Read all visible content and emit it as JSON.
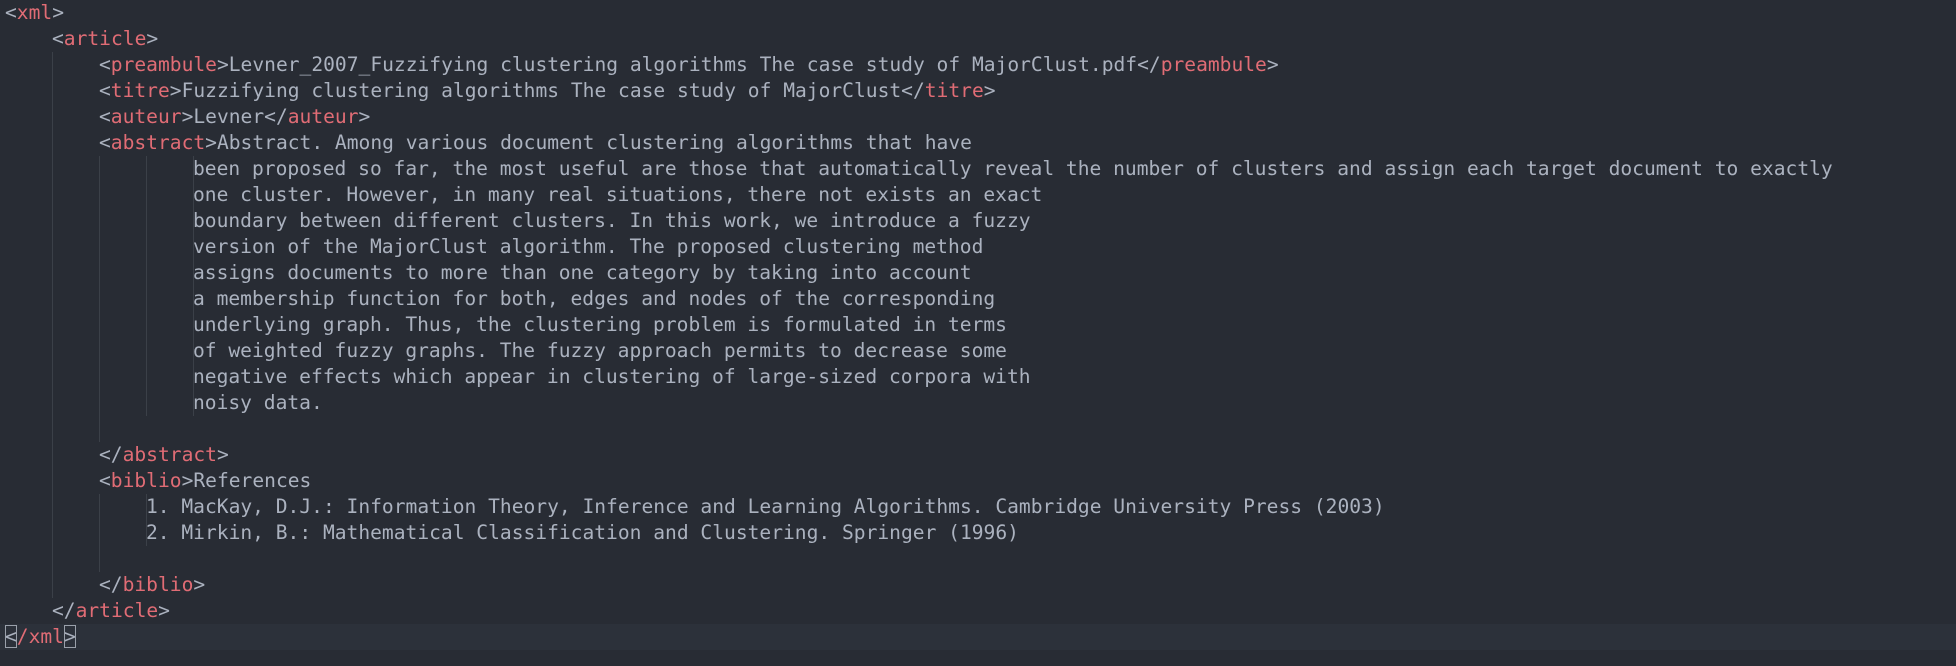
{
  "lines": [
    {
      "open": "<",
      "tag": "xml",
      "close": ">",
      "text": ""
    },
    {
      "open": "<",
      "tag": "article",
      "close": ">",
      "text": ""
    },
    {
      "open": "<",
      "tag": "preambule",
      "close": ">",
      "text": "Levner_2007_Fuzzifying clustering algorithms The case study of MajorClust.pdf",
      "end_open": "</",
      "end_tag": "preambule",
      "end_close": ">"
    },
    {
      "open": "<",
      "tag": "titre",
      "close": ">",
      "text": "Fuzzifying clustering algorithms The case study of MajorClust",
      "end_open": "</",
      "end_tag": "titre",
      "end_close": ">"
    },
    {
      "open": "<",
      "tag": "auteur",
      "close": ">",
      "text": "Levner",
      "end_open": "</",
      "end_tag": "auteur",
      "end_close": ">"
    },
    {
      "open": "<",
      "tag": "abstract",
      "close": ">",
      "text": "Abstract. Among various document clustering algorithms that have"
    },
    {
      "text": "been proposed so far, the most useful are those that automatically reveal the number of clusters and assign each target document to exactly"
    },
    {
      "text": "one cluster. However, in many real situations, there not exists an exact"
    },
    {
      "text": "boundary between different clusters. In this work, we introduce a fuzzy"
    },
    {
      "text": "version of the MajorClust algorithm. The proposed clustering method"
    },
    {
      "text": "assigns documents to more than one category by taking into account"
    },
    {
      "text": "a membership function for both, edges and nodes of the corresponding"
    },
    {
      "text": "underlying graph. Thus, the clustering problem is formulated in terms"
    },
    {
      "text": "of weighted fuzzy graphs. The fuzzy approach permits to decrease some"
    },
    {
      "text": "negative effects which appear in clustering of large-sized corpora with"
    },
    {
      "text": "noisy data."
    },
    {
      "text": ""
    },
    {
      "open": "</",
      "tag": "abstract",
      "close": ">",
      "text": ""
    },
    {
      "open": "<",
      "tag": "biblio",
      "close": ">",
      "text": "References"
    },
    {
      "text": "1. MacKay, D.J.: Information Theory, Inference and Learning Algorithms. Cambridge University Press (2003)"
    },
    {
      "text": "2. Mirkin, B.: Mathematical Classification and Clustering. Springer (1996)"
    },
    {
      "text": ""
    },
    {
      "open": "</",
      "tag": "biblio",
      "close": ">",
      "text": ""
    },
    {
      "open": "</",
      "tag": "article",
      "close": ">",
      "text": ""
    },
    {
      "open": "<",
      "open_hl": true,
      "tag": "/xml",
      "close": ">",
      "close_hl": true,
      "text": ""
    }
  ]
}
